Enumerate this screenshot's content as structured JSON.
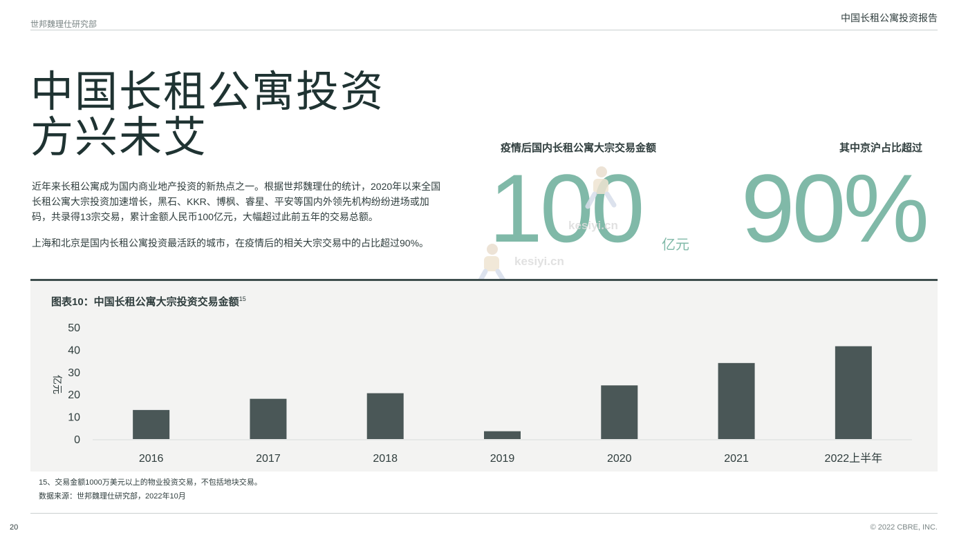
{
  "header": {
    "left_text": "世邦魏理仕研究部",
    "right_text": "中国长租公寓投资报告"
  },
  "headline": {
    "line1": "中国长租公寓投资",
    "line2": "方兴未艾"
  },
  "paragraphs": [
    "近年来长租公寓成为国内商业地产投资的新热点之一。根据世邦魏理仕的统计，2020年以来全国长租公寓大宗投资加速增长，黑石、KKR、博枫、睿星、平安等国内外领先机构纷纷进场或加码，共录得13宗交易，累计金额人民币100亿元，大幅超过此前五年的交易总额。",
    "上海和北京是国内长租公寓投资最活跃的城市，在疫情后的相关大宗交易中的占比超过90%。"
  ],
  "kpis": [
    {
      "label": "疫情后国内长租公寓大宗交易金额",
      "value": "100",
      "unit": "亿元"
    },
    {
      "label": "其中京沪占比超过",
      "value": "90%",
      "unit": ""
    }
  ],
  "watermark": "kesiyi.cn",
  "colors": {
    "accent_green": "#80b9a8",
    "bar_color": "#4a5757",
    "panel_bg": "#f3f3f2",
    "text_dark": "#2f3d3d"
  },
  "chart_data": {
    "type": "bar",
    "title": "图表10：中国长租公寓大宗投资交易金额",
    "title_superscript": "15",
    "categories": [
      "2016",
      "2017",
      "2018",
      "2019",
      "2020",
      "2021",
      "2022上半年"
    ],
    "values": [
      13,
      18,
      20.5,
      3.5,
      24,
      34,
      41.5
    ],
    "ylabel": "亿元",
    "xlabel": "",
    "ylim": [
      0,
      50
    ],
    "yticks": [
      0,
      10,
      20,
      30,
      40,
      50
    ],
    "grid": false,
    "legend": "none"
  },
  "footnotes": [
    "15、交易金额1000万美元以上的物业投资交易，不包括地块交易。",
    "数据来源：世邦魏理仕研究部，2022年10月"
  ],
  "footer": {
    "page_number": "20",
    "copyright": "© 2022 CBRE, INC."
  }
}
